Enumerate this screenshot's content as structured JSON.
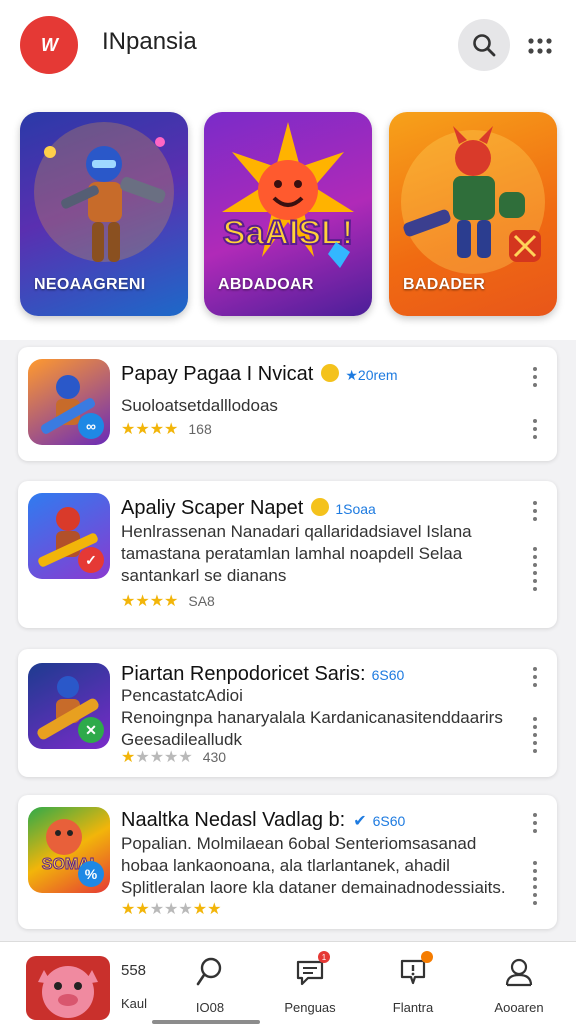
{
  "header": {
    "logo_text": "W",
    "app_title": "INpansia",
    "search_icon": "search-icon",
    "more_icon": "grid-dots-icon"
  },
  "featured": [
    {
      "label": "NEOAAGRENI",
      "bg": "#3a35b4",
      "icon": "hero-blaster-art"
    },
    {
      "label": "ABDADOAR",
      "bg": "#8d2bc2",
      "art_text": "SaAISL!",
      "icon": "sunburst-logo-art"
    },
    {
      "label": "BADADER",
      "bg": "#f28a18",
      "icon": "hero-armor-art"
    }
  ],
  "cards": [
    {
      "title": "Papay Pagaa I Nvicat",
      "meta": "20rem",
      "desc": [
        "Suoloatsetdalllodoas"
      ],
      "rating_count": "168",
      "badge_color": "#1e88e5",
      "badge_glyph": "∞"
    },
    {
      "title": "Apaliy Scaper Napet",
      "meta": "1Soaa",
      "desc": [
        "Henlrassenan Nanadari qallaridadsiavel Islana",
        "tamastana peratamlan lamhal noapdell Selaa",
        "santankarl se dianans"
      ],
      "rating_count": "SA8",
      "badge_color": "#e53935",
      "badge_glyph": "✓"
    },
    {
      "title": "Piartan Renpodoricet Saris:",
      "meta": "6S60",
      "desc": [
        "PencastatcAdioi",
        "Renoingnpa hanaryalala Kardanicanasitenddaarirs",
        "Geesadilealludk"
      ],
      "rating_count": "430",
      "badge_color": "#2eaa4a",
      "badge_glyph": "✕"
    },
    {
      "title": "Naaltka Nedasl Vadlag b:",
      "meta": "6S60",
      "desc": [
        "Popalian. Molmilaean 6obal Senteriomsasanad",
        "hobaa lankaonoana, ala tlarlantanek, ahadil",
        "Splitleralan laore kla dataner demainadnodessiaits."
      ],
      "rating_count": "",
      "badge_color": "#1e88e5",
      "badge_glyph": "%"
    }
  ],
  "bottom_nav": {
    "profile_number": "558",
    "profile_label": "Kaul",
    "items": [
      {
        "label": "IO08",
        "icon": "search-icon"
      },
      {
        "label": "Penguas",
        "icon": "chat-icon",
        "badge": "1"
      },
      {
        "label": "Flantra",
        "icon": "alert-icon",
        "badge": ""
      },
      {
        "label": "Aooaren",
        "icon": "profile-icon"
      }
    ]
  },
  "colors": {
    "accent_red": "#e53935",
    "accent_blue": "#1e7be0",
    "star": "#f2b50a"
  }
}
